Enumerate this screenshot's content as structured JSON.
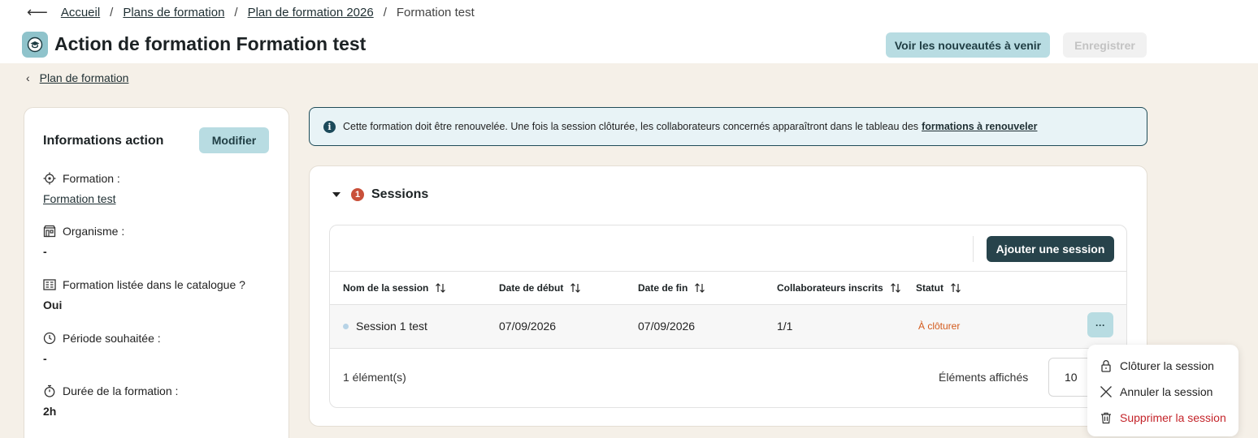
{
  "breadcrumb": {
    "back_icon": "arrow-left-icon",
    "items": [
      "Accueil",
      "Plans de formation",
      "Plan de formation 2026"
    ],
    "current": "Formation test",
    "separator": "/"
  },
  "header": {
    "icon": "graduation-cap-icon",
    "title": "Action de formation Formation test",
    "news_button": "Voir les nouveautés à venir",
    "save_button": "Enregistrer"
  },
  "back_link": "Plan de formation",
  "info_card": {
    "title": "Informations action",
    "modify_button": "Modifier",
    "items": [
      {
        "label": "Formation :",
        "value": "Formation test",
        "icon": "target-icon"
      },
      {
        "label": "Organisme :",
        "value": "-",
        "icon": "building-icon"
      },
      {
        "label": "Formation listée dans le catalogue ?",
        "value": "Oui",
        "icon": "catalog-icon"
      },
      {
        "label": "Période souhaitée :",
        "value": "-",
        "icon": "clock-icon"
      },
      {
        "label": "Durée de la formation :",
        "value": "2h",
        "icon": "stopwatch-icon"
      }
    ]
  },
  "alert": {
    "icon": "info-icon",
    "text": "Cette formation doit être renouvelée. Une fois la session clôturée, les collaborateurs concernés apparaîtront dans le tableau des",
    "link": "formations à renouveler"
  },
  "sessions": {
    "count": "1",
    "title": "Sessions",
    "add_button": "Ajouter une session",
    "columns": [
      "Nom de la session",
      "Date de début",
      "Date de fin",
      "Collaborateurs inscrits",
      "Statut"
    ],
    "rows": [
      {
        "name": "Session 1 test",
        "start": "07/09/2026",
        "end": "07/09/2026",
        "enrolled": "1/1",
        "status": "À clôturer"
      }
    ],
    "more_button": "···",
    "footer_count": "1 élément(s)",
    "page_size_label": "Éléments affichés",
    "page_size": "10"
  },
  "context_menu": {
    "items": [
      {
        "label": "Clôturer la session",
        "icon": "lock-icon"
      },
      {
        "label": "Annuler la session",
        "icon": "close-icon"
      },
      {
        "label": "Supprimer la session",
        "icon": "trash-icon"
      }
    ]
  },
  "colors": {
    "accent": "#b8dce2",
    "primary_dark": "#27434b",
    "status_warning": "#d35a1c",
    "danger": "#c4242a",
    "page_background": "#f5f0e8"
  }
}
